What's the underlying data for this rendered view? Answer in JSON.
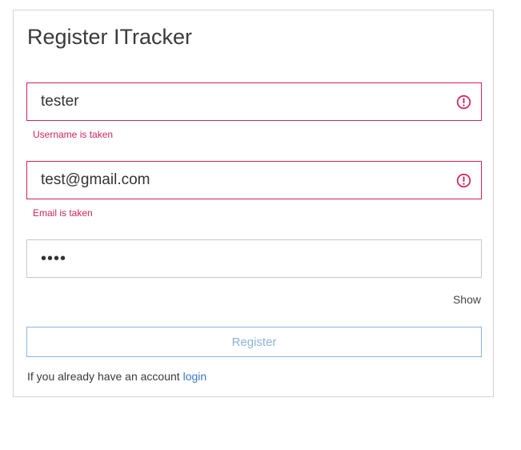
{
  "form": {
    "title": "Register ITracker",
    "username": {
      "value": "tester",
      "error": "Username is taken"
    },
    "email": {
      "value": "test@gmail.com",
      "error": "Email is taken"
    },
    "password": {
      "value": "test"
    },
    "show_label": "Show",
    "register_label": "Register",
    "footer_text": "If you already have an account",
    "login_label": "login"
  },
  "colors": {
    "error": "#d1245a",
    "button_border": "#8bb3dd",
    "link": "#3b78c4"
  },
  "icons": {
    "field_error": "exclamation-circle-icon"
  }
}
